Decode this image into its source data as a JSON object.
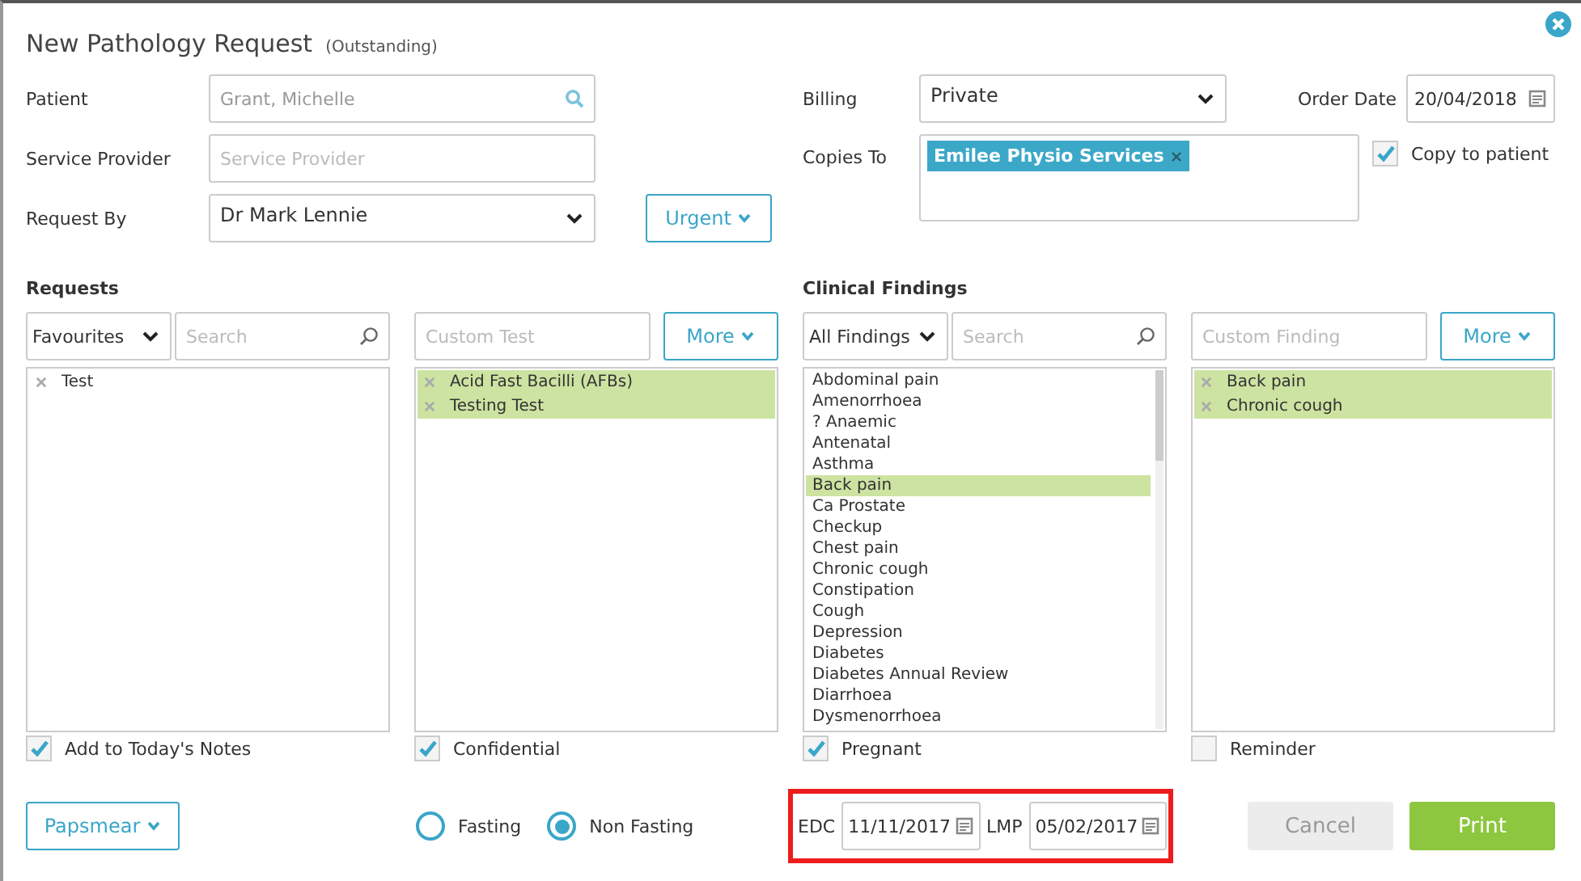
{
  "dialog": {
    "title": "New Pathology Request",
    "status": "(Outstanding)"
  },
  "patient": {
    "label": "Patient",
    "value": "Grant, Michelle"
  },
  "service_provider": {
    "label": "Service Provider",
    "placeholder": "Service Provider"
  },
  "request_by": {
    "label": "Request By",
    "value": "Dr Mark Lennie"
  },
  "urgent_button": "Urgent",
  "billing": {
    "label": "Billing",
    "value": "Private"
  },
  "order_date": {
    "label": "Order Date",
    "value": "20/04/2018"
  },
  "copies_to": {
    "label": "Copies To",
    "tags": [
      "Emilee Physio Services"
    ]
  },
  "copy_to_patient": {
    "label": "Copy to patient",
    "checked": true
  },
  "requests": {
    "heading": "Requests",
    "filter": "Favourites",
    "search_placeholder": "Search",
    "custom_placeholder": "Custom Test",
    "more_button": "More",
    "available": [
      {
        "label": "Test"
      }
    ],
    "chosen": [
      {
        "label": "Acid Fast Bacilli (AFBs)"
      },
      {
        "label": "Testing Test"
      }
    ]
  },
  "findings": {
    "heading": "Clinical Findings",
    "filter": "All Findings",
    "search_placeholder": "Search",
    "custom_placeholder": "Custom Finding",
    "more_button": "More",
    "available": [
      {
        "label": "Abdominal pain",
        "selected": false
      },
      {
        "label": "Amenorrhoea",
        "selected": false
      },
      {
        "label": "? Anaemic",
        "selected": false
      },
      {
        "label": "Antenatal",
        "selected": false
      },
      {
        "label": "Asthma",
        "selected": false
      },
      {
        "label": "Back pain",
        "selected": true
      },
      {
        "label": "Ca Prostate",
        "selected": false
      },
      {
        "label": "Checkup",
        "selected": false
      },
      {
        "label": "Chest pain",
        "selected": false
      },
      {
        "label": "Chronic cough",
        "selected": false
      },
      {
        "label": "Constipation",
        "selected": false
      },
      {
        "label": "Cough",
        "selected": false
      },
      {
        "label": "Depression",
        "selected": false
      },
      {
        "label": "Diabetes",
        "selected": false
      },
      {
        "label": "Diabetes Annual Review",
        "selected": false
      },
      {
        "label": "Diarrhoea",
        "selected": false
      },
      {
        "label": "Dysmenorrhoea",
        "selected": false
      }
    ],
    "chosen": [
      {
        "label": "Back pain"
      },
      {
        "label": "Chronic cough"
      }
    ]
  },
  "checkboxes": [
    {
      "label": "Add to Today's Notes",
      "checked": true
    },
    {
      "label": "Confidential",
      "checked": true
    },
    {
      "label": "Pregnant",
      "checked": true
    },
    {
      "label": "Reminder",
      "checked": false
    }
  ],
  "papsmear_button": "Papsmear",
  "fasting": [
    {
      "label": "Fasting",
      "selected": false
    },
    {
      "label": "Non Fasting",
      "selected": true
    }
  ],
  "edc": {
    "label": "EDC",
    "value": "11/11/2017"
  },
  "lmp": {
    "label": "LMP",
    "value": "05/02/2017"
  },
  "buttons": [
    {
      "label": "Cancel",
      "kind": "secondary"
    },
    {
      "label": "Print",
      "kind": "primary"
    }
  ]
}
